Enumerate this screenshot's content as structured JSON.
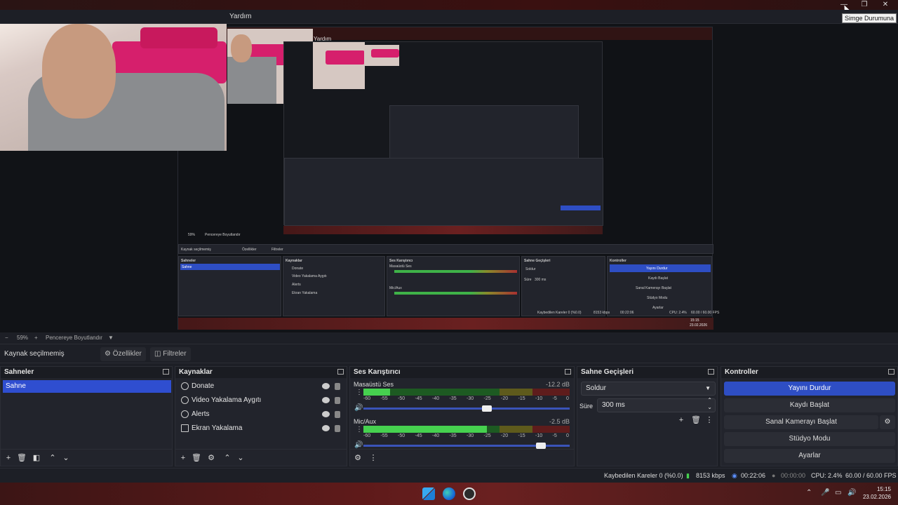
{
  "window": {
    "minimize_glyph": "—",
    "restore_glyph": "❐",
    "close_glyph": "✕",
    "tooltip": "Simge Durumuna"
  },
  "menubar": {
    "help": "Yardım"
  },
  "nested_preview": {
    "help": "Yardım",
    "source_none": "Kaynak seçilmemiş",
    "properties": "Özellikler",
    "filters": "Filtreler",
    "zoom": "59%",
    "resize": "Pencereye Boyutlandır",
    "scenes_title": "Sahneler",
    "scene_item": "Sahne",
    "sources_title": "Kaynaklar",
    "sources": [
      "Donate",
      "Video Yakalama Aygıtı",
      "Alerts",
      "Ekran Yakalama"
    ],
    "mixer_title": "Ses Karıştırıcı",
    "mixer_ch1": "Masaüstü Ses",
    "mixer_ch2": "Mic/Aux",
    "transitions_title": "Sahne Geçişleri",
    "transition": "Soldur",
    "duration_label": "Süre",
    "duration": "300 ms",
    "controls_title": "Kontroller",
    "controls": [
      "Yayını Durdur",
      "Kaydı Başlat",
      "Sanal Kamerayı Başlat",
      "Stüdyo Modu",
      "Ayarlar"
    ],
    "status": "Kaybedilen Kareler 0 (%0.0)",
    "bitrate": "8153 kbps",
    "time": "00:22:06",
    "cpu": "CPU: 2.4%",
    "fps": "60.00 / 60.00 FPS",
    "clock_time": "15:15",
    "clock_date": "23.02.2026"
  },
  "zoombar": {
    "minus": "−",
    "zoom": "59%",
    "plus": "+",
    "resize": "Pencereye Boyutlandır",
    "caret": "▼"
  },
  "toolbar": {
    "source_none": "Kaynak seçilmemiş",
    "properties": "Özellikler",
    "filters": "Filtreler"
  },
  "scenes": {
    "title": "Sahneler",
    "items": [
      "Sahne"
    ]
  },
  "sources": {
    "title": "Kaynaklar",
    "items": [
      {
        "label": "Donate",
        "icon": "globe-icon"
      },
      {
        "label": "Video Yakalama Aygıtı",
        "icon": "camera-icon"
      },
      {
        "label": "Alerts",
        "icon": "globe-icon"
      },
      {
        "label": "Ekran Yakalama",
        "icon": "monitor-icon"
      }
    ]
  },
  "mixer": {
    "title": "Ses Karıştırıcı",
    "channels": [
      {
        "name": "Masaüstü Ses",
        "db": "-12.2 dB",
        "level": 0.13,
        "volume": 0.6
      },
      {
        "name": "Mic/Aux",
        "db": "-2.5 dB",
        "level": 0.6,
        "volume": 0.86
      }
    ],
    "ticks": [
      "-60",
      "-55",
      "-50",
      "-45",
      "-40",
      "-35",
      "-30",
      "-25",
      "-20",
      "-15",
      "-10",
      "-5",
      "0"
    ]
  },
  "transitions": {
    "title": "Sahne Geçişleri",
    "selected": "Soldur",
    "duration_label": "Süre",
    "duration": "300 ms"
  },
  "controls": {
    "title": "Kontroller",
    "stop_stream": "Yayını Durdur",
    "start_record": "Kaydı Başlat",
    "virtual_cam": "Sanal Kamerayı Başlat",
    "studio_mode": "Stüdyo Modu",
    "settings": "Ayarlar"
  },
  "statusbar": {
    "dropped": "Kaybedilen Kareler 0 (%0.0)",
    "bitrate": "8153 kbps",
    "stream_time": "00:22:06",
    "record_time": "00:00:00",
    "cpu": "CPU: 2.4%",
    "fps": "60.00 / 60.00 FPS"
  },
  "taskbar": {
    "time": "15:15",
    "date": "23.02.2026"
  },
  "colors": {
    "accent": "#2e4ec4",
    "taskbar": "#5e1a1a",
    "meter_green": "#46d14f"
  }
}
